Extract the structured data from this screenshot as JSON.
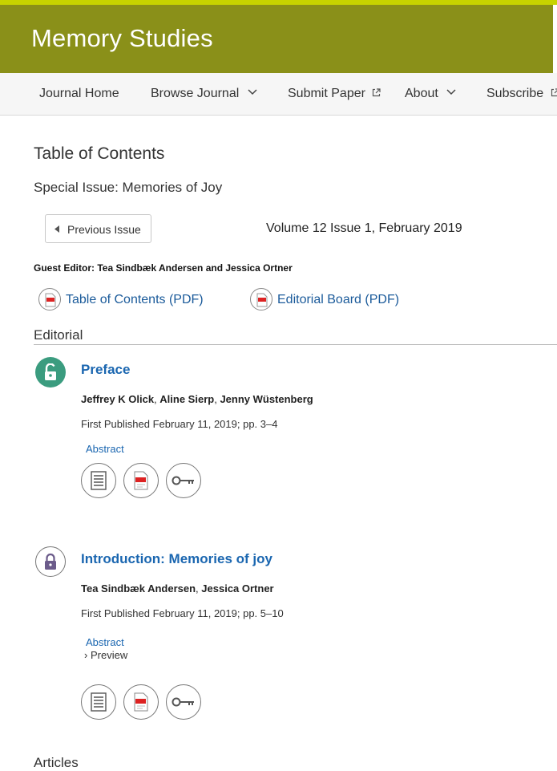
{
  "header": {
    "title": "Memory Studies"
  },
  "nav": {
    "journal_home": "Journal Home",
    "browse_journal": "Browse Journal",
    "submit_paper": "Submit Paper",
    "about": "About",
    "subscribe": "Subscribe"
  },
  "toc": {
    "title": "Table of Contents",
    "special_issue": "Special Issue: Memories of Joy",
    "previous_issue": "Previous Issue",
    "volume": "Volume 12 Issue 1, February 2019",
    "guest_editor": "Guest Editor: Tea Sindbæk Andersen and Jessica Ortner",
    "toc_pdf": "Table of Contents (PDF)",
    "board_pdf": "Editorial Board (PDF)"
  },
  "sections": {
    "editorial": "Editorial",
    "articles": "Articles"
  },
  "articles": [
    {
      "title": "Preface",
      "authors": [
        "Jeffrey K Olick",
        "Aline Sierp",
        "Jenny Wüstenberg"
      ],
      "published": "First Published February 11, 2019; pp. 3–4",
      "abstract": "Abstract"
    },
    {
      "title": "Introduction: Memories of joy",
      "authors": [
        "Tea Sindbæk Andersen",
        "Jessica Ortner"
      ],
      "published": "First Published February 11, 2019; pp. 5–10",
      "abstract": "Abstract",
      "preview": "Preview"
    }
  ],
  "separators": {
    "comma": ", ",
    "chevron": "›"
  },
  "colors": {
    "header_bg": "#8a9019",
    "accent_stripe": "#c7d300",
    "link": "#1a66b0",
    "open_access": "#3b9c7f"
  },
  "icons": {
    "open": "lock-open-icon",
    "closed": "lock-icon",
    "fulltext": "document-icon",
    "pdf": "pdf-icon",
    "permissions": "key-icon"
  }
}
